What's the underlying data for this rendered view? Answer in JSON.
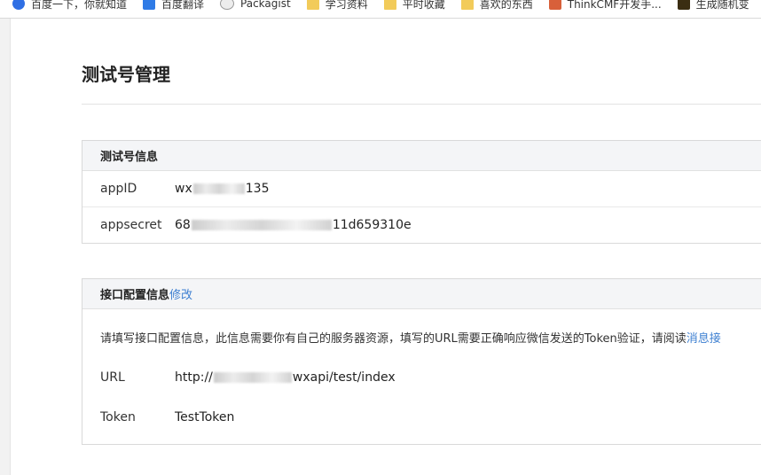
{
  "bookmarks": [
    {
      "icon": "baidu-icon",
      "label": "百度一下，你就知道"
    },
    {
      "icon": "fanyi-icon",
      "label": "百度翻译"
    },
    {
      "icon": "packagist-icon",
      "label": "Packagist"
    },
    {
      "icon": "folder-icon",
      "label": "学习资料"
    },
    {
      "icon": "folder-icon",
      "label": "平时收藏"
    },
    {
      "icon": "folder-icon",
      "label": "喜欢的东西"
    },
    {
      "icon": "thinkcmf-icon",
      "label": "ThinkCMF开发手..."
    },
    {
      "icon": "generator-icon",
      "label": "生成随机变"
    }
  ],
  "page": {
    "title": "测试号管理"
  },
  "test_info": {
    "heading": "测试号信息",
    "appid_label": "appID",
    "appid_prefix": "wx",
    "appid_suffix": "135",
    "appsecret_label": "appsecret",
    "appsecret_prefix": "68",
    "appsecret_suffix": "11d659310e"
  },
  "interface_config": {
    "heading": "接口配置信息",
    "edit_label": "修改",
    "notice": "请填写接口配置信息，此信息需要你有自己的服务器资源，填写的URL需要正确响应微信发送的Token验证，请阅读",
    "notice_link": "消息接",
    "url_label": "URL",
    "url_prefix": "http://",
    "url_suffix": "wxapi/test/index",
    "token_label": "Token",
    "token_value": "TestToken"
  }
}
